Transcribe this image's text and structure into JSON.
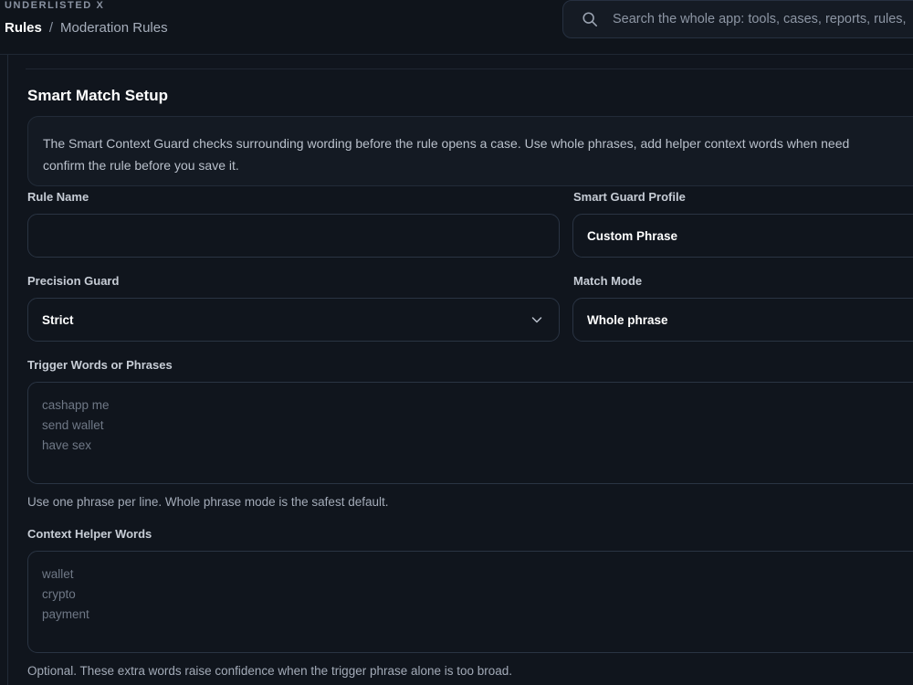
{
  "app": {
    "brand": "UNDERLISTED X"
  },
  "breadcrumb": {
    "root": "Rules",
    "separator": "/",
    "current": "Moderation Rules"
  },
  "search": {
    "placeholder": "Search the whole app: tools, cases, reports, rules,"
  },
  "section": {
    "title": "Smart Match Setup",
    "info_line1": "The Smart Context Guard checks surrounding wording before the rule opens a case. Use whole phrases, add helper context words when need",
    "info_line2": "confirm the rule before you save it."
  },
  "form": {
    "rule_name": {
      "label": "Rule Name",
      "value": ""
    },
    "profile": {
      "label": "Smart Guard Profile",
      "value": "Custom Phrase"
    },
    "precision": {
      "label": "Precision Guard",
      "value": "Strict"
    },
    "match_mode": {
      "label": "Match Mode",
      "value": "Whole phrase"
    },
    "triggers": {
      "label": "Trigger Words or Phrases",
      "placeholder_lines": [
        "cashapp me",
        "send wallet",
        "have sex"
      ],
      "hint": "Use one phrase per line. Whole phrase mode is the safest default."
    },
    "context": {
      "label": "Context Helper Words",
      "placeholder_lines": [
        "wallet",
        "crypto",
        "payment"
      ],
      "hint": "Optional. These extra words raise confidence when the trigger phrase alone is too broad."
    }
  },
  "icons": {
    "search": "search-icon",
    "chevron": "chevron-down-icon"
  },
  "colors": {
    "background": "#10151d",
    "border": "#2a3443",
    "text": "#ffffff",
    "muted": "#a3abb8"
  }
}
